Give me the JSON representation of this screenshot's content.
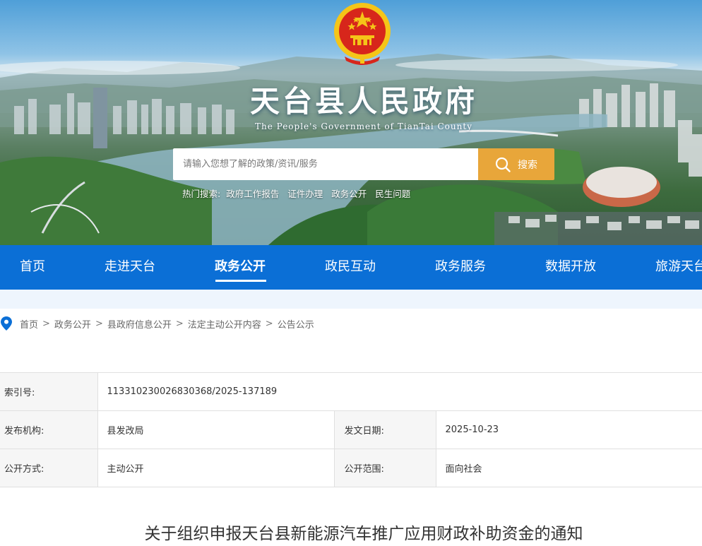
{
  "header": {
    "title": "天台县人民政府",
    "subtitle": "The People's Government of TianTai County"
  },
  "search": {
    "placeholder": "请输入您想了解的政策/资讯/服务",
    "button_label": "搜索"
  },
  "hot_search": {
    "label": "热门搜索:",
    "items": [
      "政府工作报告",
      "证件办理",
      "政务公开",
      "民生问题"
    ]
  },
  "nav": {
    "items": [
      "首页",
      "走进天台",
      "政务公开",
      "政民互动",
      "政务服务",
      "数据开放",
      "旅游天台"
    ],
    "active": "政务公开"
  },
  "breadcrumb": {
    "items": [
      "首页",
      "政务公开",
      "县政府信息公开",
      "法定主动公开内容",
      "公告公示"
    ],
    "separator": ">"
  },
  "info": {
    "index_label": "索引号:",
    "index_value": "11331023002683036​8/2025-137189",
    "publisher_label": "发布机构:",
    "publisher_value": "县发改局",
    "date_label": "发文日期:",
    "date_value": "2025-10-23",
    "method_label": "公开方式:",
    "method_value": "主动公开",
    "scope_label": "公开范围:",
    "scope_value": "面向社会"
  },
  "document": {
    "title": "关于组织申报天台县新能源汽车推广应用财政补助资金的通知"
  },
  "colors": {
    "nav_blue": "#0b6fd6",
    "search_button": "#e8a63a",
    "emblem_red": "#d7261b",
    "emblem_gold": "#f5c518"
  },
  "icons": {
    "search": "search-icon",
    "location": "location-pin-icon",
    "emblem": "national-emblem-icon"
  }
}
